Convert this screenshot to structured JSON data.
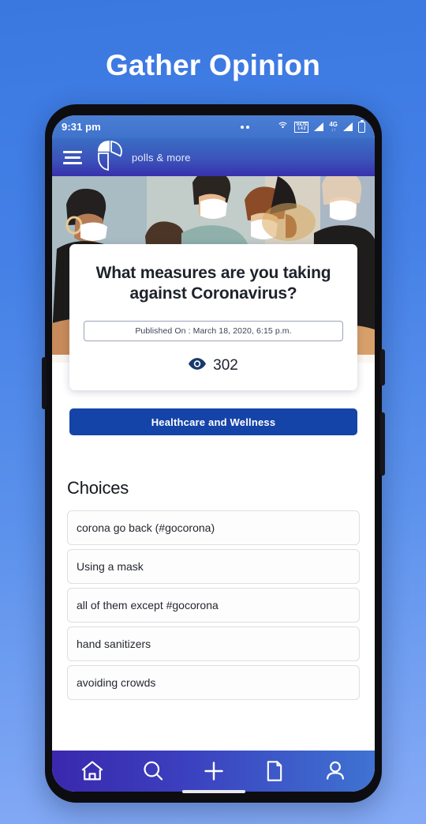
{
  "page": {
    "title": "Gather Opinion",
    "background_color": "#3c7ce2"
  },
  "phone": {
    "statusbar": {
      "time": "9:31 pm",
      "icons": [
        "notification-dots",
        "hotspot-icon",
        "volte-icon",
        "signal-icon",
        "4g-icon",
        "signal-icon-2",
        "battery-icon"
      ],
      "volte_top": "VoLTE",
      "volte_bottom": "1 4 2",
      "network": "4G",
      "network_sub": "↓↑"
    },
    "appbar": {
      "menu_label": "menu",
      "brand": "polls & more",
      "logo_name": "pie-chart-logo",
      "accent_color": "#3731ad"
    },
    "poll": {
      "question": "What measures are you taking against Coronavirus?",
      "published": "Published On : March 18, 2020, 6:15 p.m.",
      "views": "302",
      "views_icon": "eye-icon",
      "views_icon_color": "#17396b"
    },
    "category": {
      "label": "Healthcare and Wellness",
      "color": "#1544a8"
    },
    "choices": {
      "heading": "Choices",
      "items": [
        {
          "label": "corona go back (#gocorona)"
        },
        {
          "label": "Using a mask"
        },
        {
          "label": "all of them except #gocorona"
        },
        {
          "label": "hand sanitizers"
        },
        {
          "label": "avoiding crowds"
        }
      ]
    },
    "bottomnav": {
      "items": [
        {
          "name": "home-icon",
          "label": "Home"
        },
        {
          "name": "search-icon",
          "label": "Search"
        },
        {
          "name": "plus-icon",
          "label": "Create"
        },
        {
          "name": "document-icon",
          "label": "Polls"
        },
        {
          "name": "person-icon",
          "label": "Profile"
        }
      ]
    }
  }
}
